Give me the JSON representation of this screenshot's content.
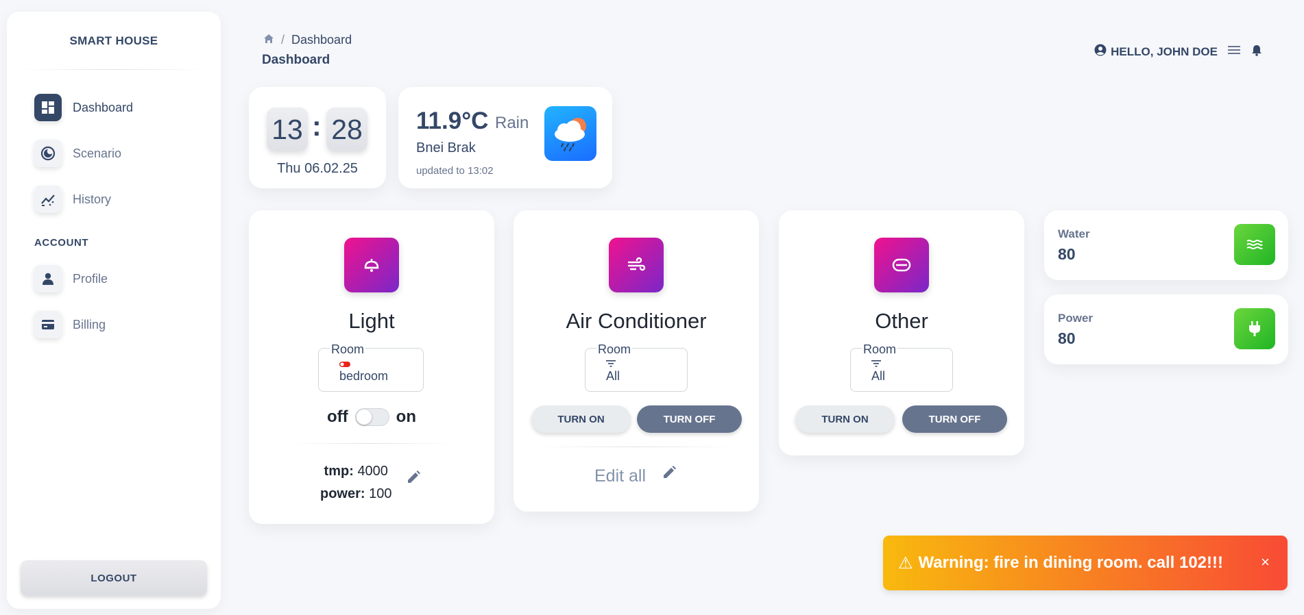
{
  "sidebar": {
    "brand": "SMART HOUSE",
    "items": [
      {
        "label": "Dashboard",
        "icon": "dashboard-icon"
      },
      {
        "label": "Scenario",
        "icon": "scenario-icon"
      },
      {
        "label": "History",
        "icon": "history-icon"
      }
    ],
    "account_title": "ACCOUNT",
    "account_items": [
      {
        "label": "Profile",
        "icon": "person-icon"
      },
      {
        "label": "Billing",
        "icon": "credit-card-icon"
      }
    ],
    "logout_label": "LOGOUT"
  },
  "header": {
    "breadcrumb": {
      "sep": "/",
      "current": "Dashboard"
    },
    "title": "Dashboard",
    "greeting": "HELLO, JOHN DOE"
  },
  "clock": {
    "hours": "13",
    "sep": ":",
    "minutes": "28",
    "date": "Thu 06.02.25"
  },
  "weather": {
    "temp": "11.9°C",
    "condition": "Rain",
    "city": "Bnei Brak",
    "updated": "updated to 13:02"
  },
  "devices": {
    "light": {
      "title": "Light",
      "room_label": "Room",
      "room_value": "bedroom",
      "off_label": "off",
      "on_label": "on",
      "tmp_label": "tmp:",
      "tmp_value": "4000",
      "power_label": "power:",
      "power_value": "100"
    },
    "ac": {
      "title": "Air Conditioner",
      "room_label": "Room",
      "room_value": "All",
      "turn_on": "TURN ON",
      "turn_off": "TURN OFF",
      "edit_all": "Edit all"
    },
    "other": {
      "title": "Other",
      "room_label": "Room",
      "room_value": "All",
      "turn_on": "TURN ON",
      "turn_off": "TURN OFF"
    }
  },
  "stats": {
    "water": {
      "label": "Water",
      "value": "80"
    },
    "power": {
      "label": "Power",
      "value": "80"
    }
  },
  "alert": {
    "icon": "⚠",
    "message": "Warning: fire in dining room. call 102!!!",
    "close": "×"
  },
  "colors": {
    "accent": "#344767",
    "device_gradient": [
      "#f0128e",
      "#7a27c9"
    ],
    "stat_gradient": [
      "#6bd63d",
      "#20b525"
    ],
    "alert_gradient": [
      "#f8b90e",
      "#f84b35"
    ]
  }
}
